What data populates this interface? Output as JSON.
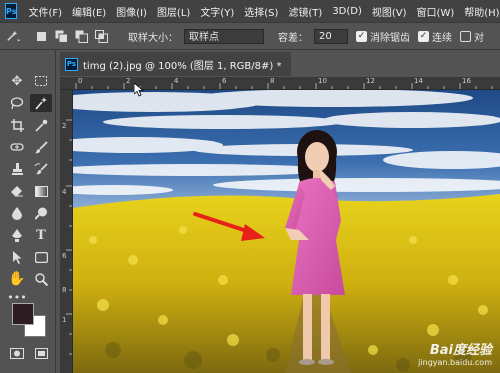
{
  "menubar": {
    "logo": "Ps",
    "items": [
      "文件(F)",
      "编辑(E)",
      "图像(I)",
      "图层(L)",
      "文字(Y)",
      "选择(S)",
      "滤镜(T)",
      "3D(D)",
      "视图(V)",
      "窗口(W)",
      "帮助(H)"
    ]
  },
  "options": {
    "sample_size_label": "取样大小：",
    "sample_size_value": "取样点",
    "tolerance_label": "容差：",
    "tolerance_value": "20",
    "antialias_label": "消除锯齿",
    "contiguous_label": "连续",
    "all_layers_label": "对"
  },
  "document": {
    "logo": "Ps",
    "tab_title": "timg (2).jpg @ 100% (图层 1, RGB/8#) *"
  },
  "rulers": {
    "top": [
      "0",
      "2",
      "4",
      "6",
      "8",
      "10",
      "12",
      "14",
      "16"
    ],
    "left": [
      "2",
      "4",
      "6",
      "8",
      "1"
    ]
  },
  "colors": {
    "foreground": "#2d1d22",
    "background": "#ffffff",
    "arrow": "#e8201a"
  },
  "icons": {
    "move": "move-icon",
    "marquee": "rect-marquee-icon",
    "lasso": "lasso-icon",
    "magic_wand": "magic-wand-icon",
    "crop": "crop-icon",
    "eyedropper": "eyedropper-icon",
    "healing": "healing-brush-icon",
    "brush": "brush-icon",
    "clone": "clone-stamp-icon",
    "history_brush": "history-brush-icon",
    "eraser": "eraser-icon",
    "gradient": "gradient-icon",
    "blur": "blur-icon",
    "dodge": "dodge-icon",
    "pen": "pen-icon",
    "type": "type-icon",
    "path_select": "path-selection-icon",
    "shape": "rectangle-shape-icon",
    "hand": "hand-icon",
    "zoom": "zoom-icon",
    "more": "more-tools-icon"
  },
  "watermark": {
    "main": "Bai度经验",
    "sub": "jingyan.baidu.com"
  }
}
